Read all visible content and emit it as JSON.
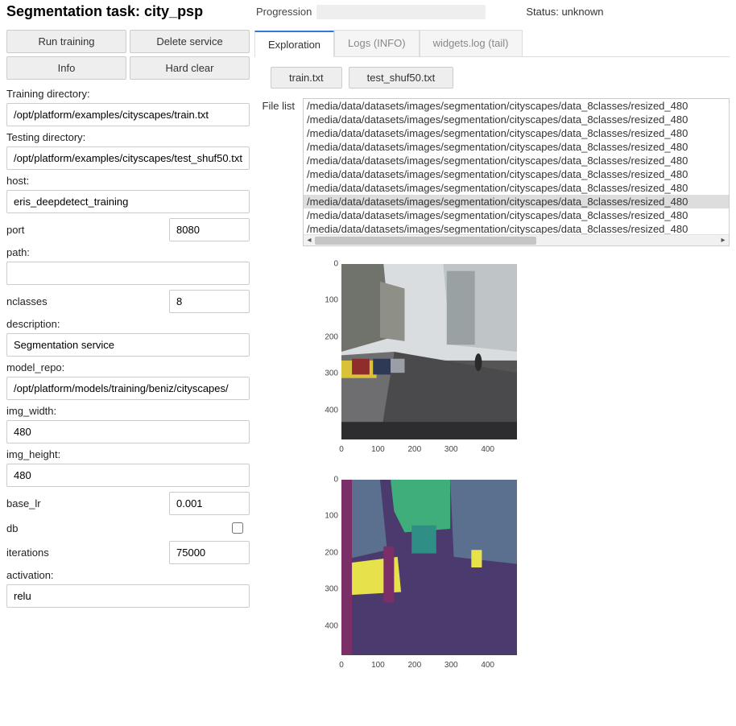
{
  "header": {
    "title": "Segmentation task: city_psp",
    "progression_label": "Progression",
    "status_label_prefix": "Status: ",
    "status_value": "unknown"
  },
  "buttons": {
    "run_training": "Run training",
    "delete_service": "Delete service",
    "info": "Info",
    "hard_clear": "Hard clear"
  },
  "form": {
    "training_dir_label": "Training directory:",
    "training_dir": "/opt/platform/examples/cityscapes/train.txt",
    "testing_dir_label": "Testing directory:",
    "testing_dir": "/opt/platform/examples/cityscapes/test_shuf50.txt",
    "host_label": "host:",
    "host": "eris_deepdetect_training",
    "port_label": "port",
    "port": "8080",
    "path_label": "path:",
    "path": "",
    "nclasses_label": "nclasses",
    "nclasses": "8",
    "description_label": "description:",
    "description": "Segmentation service",
    "model_repo_label": "model_repo:",
    "model_repo": "/opt/platform/models/training/beniz/cityscapes/",
    "img_width_label": "img_width:",
    "img_width": "480",
    "img_height_label": "img_height:",
    "img_height": "480",
    "base_lr_label": "base_lr",
    "base_lr": "0.001",
    "db_label": "db",
    "db_checked": false,
    "iterations_label": "iterations",
    "iterations": "75000",
    "activation_label": "activation:",
    "activation": "relu"
  },
  "tabs": {
    "exploration": "Exploration",
    "logs": "Logs (INFO)",
    "widgets": "widgets.log (tail)"
  },
  "sub_tabs": {
    "train_txt": "train.txt",
    "test_shuf": "test_shuf50.txt"
  },
  "file_list": {
    "label": "File list",
    "items": [
      "/media/data/datasets/images/segmentation/cityscapes/data_8classes/resized_480",
      "/media/data/datasets/images/segmentation/cityscapes/data_8classes/resized_480",
      "/media/data/datasets/images/segmentation/cityscapes/data_8classes/resized_480",
      "/media/data/datasets/images/segmentation/cityscapes/data_8classes/resized_480",
      "/media/data/datasets/images/segmentation/cityscapes/data_8classes/resized_480",
      "/media/data/datasets/images/segmentation/cityscapes/data_8classes/resized_480",
      "/media/data/datasets/images/segmentation/cityscapes/data_8classes/resized_480",
      "/media/data/datasets/images/segmentation/cityscapes/data_8classes/resized_480",
      "/media/data/datasets/images/segmentation/cityscapes/data_8classes/resized_480",
      "/media/data/datasets/images/segmentation/cityscapes/data_8classes/resized_480"
    ],
    "selected_index": 7
  },
  "chart_data": [
    {
      "type": "image",
      "xlim": [
        0,
        480
      ],
      "ylim": [
        0,
        480
      ],
      "xticks": [
        0,
        100,
        200,
        300,
        400
      ],
      "yticks": [
        0,
        100,
        200,
        300,
        400
      ]
    },
    {
      "type": "image",
      "xlim": [
        0,
        480
      ],
      "ylim": [
        0,
        480
      ],
      "xticks": [
        0,
        100,
        200,
        300,
        400
      ],
      "yticks": [
        0,
        100,
        200,
        300,
        400
      ]
    }
  ]
}
